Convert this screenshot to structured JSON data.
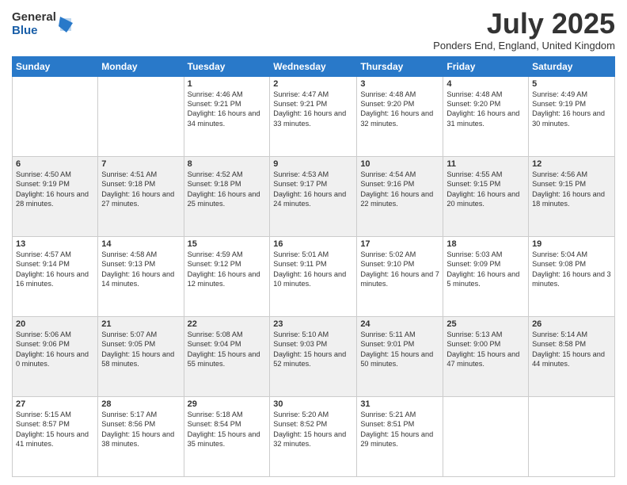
{
  "logo": {
    "general": "General",
    "blue": "Blue"
  },
  "title": "July 2025",
  "location": "Ponders End, England, United Kingdom",
  "days_header": [
    "Sunday",
    "Monday",
    "Tuesday",
    "Wednesday",
    "Thursday",
    "Friday",
    "Saturday"
  ],
  "weeks": [
    [
      {
        "day": "",
        "info": ""
      },
      {
        "day": "",
        "info": ""
      },
      {
        "day": "1",
        "info": "Sunrise: 4:46 AM\nSunset: 9:21 PM\nDaylight: 16 hours\nand 34 minutes."
      },
      {
        "day": "2",
        "info": "Sunrise: 4:47 AM\nSunset: 9:21 PM\nDaylight: 16 hours\nand 33 minutes."
      },
      {
        "day": "3",
        "info": "Sunrise: 4:48 AM\nSunset: 9:20 PM\nDaylight: 16 hours\nand 32 minutes."
      },
      {
        "day": "4",
        "info": "Sunrise: 4:48 AM\nSunset: 9:20 PM\nDaylight: 16 hours\nand 31 minutes."
      },
      {
        "day": "5",
        "info": "Sunrise: 4:49 AM\nSunset: 9:19 PM\nDaylight: 16 hours\nand 30 minutes."
      }
    ],
    [
      {
        "day": "6",
        "info": "Sunrise: 4:50 AM\nSunset: 9:19 PM\nDaylight: 16 hours\nand 28 minutes."
      },
      {
        "day": "7",
        "info": "Sunrise: 4:51 AM\nSunset: 9:18 PM\nDaylight: 16 hours\nand 27 minutes."
      },
      {
        "day": "8",
        "info": "Sunrise: 4:52 AM\nSunset: 9:18 PM\nDaylight: 16 hours\nand 25 minutes."
      },
      {
        "day": "9",
        "info": "Sunrise: 4:53 AM\nSunset: 9:17 PM\nDaylight: 16 hours\nand 24 minutes."
      },
      {
        "day": "10",
        "info": "Sunrise: 4:54 AM\nSunset: 9:16 PM\nDaylight: 16 hours\nand 22 minutes."
      },
      {
        "day": "11",
        "info": "Sunrise: 4:55 AM\nSunset: 9:15 PM\nDaylight: 16 hours\nand 20 minutes."
      },
      {
        "day": "12",
        "info": "Sunrise: 4:56 AM\nSunset: 9:15 PM\nDaylight: 16 hours\nand 18 minutes."
      }
    ],
    [
      {
        "day": "13",
        "info": "Sunrise: 4:57 AM\nSunset: 9:14 PM\nDaylight: 16 hours\nand 16 minutes."
      },
      {
        "day": "14",
        "info": "Sunrise: 4:58 AM\nSunset: 9:13 PM\nDaylight: 16 hours\nand 14 minutes."
      },
      {
        "day": "15",
        "info": "Sunrise: 4:59 AM\nSunset: 9:12 PM\nDaylight: 16 hours\nand 12 minutes."
      },
      {
        "day": "16",
        "info": "Sunrise: 5:01 AM\nSunset: 9:11 PM\nDaylight: 16 hours\nand 10 minutes."
      },
      {
        "day": "17",
        "info": "Sunrise: 5:02 AM\nSunset: 9:10 PM\nDaylight: 16 hours\nand 7 minutes."
      },
      {
        "day": "18",
        "info": "Sunrise: 5:03 AM\nSunset: 9:09 PM\nDaylight: 16 hours\nand 5 minutes."
      },
      {
        "day": "19",
        "info": "Sunrise: 5:04 AM\nSunset: 9:08 PM\nDaylight: 16 hours\nand 3 minutes."
      }
    ],
    [
      {
        "day": "20",
        "info": "Sunrise: 5:06 AM\nSunset: 9:06 PM\nDaylight: 16 hours\nand 0 minutes."
      },
      {
        "day": "21",
        "info": "Sunrise: 5:07 AM\nSunset: 9:05 PM\nDaylight: 15 hours\nand 58 minutes."
      },
      {
        "day": "22",
        "info": "Sunrise: 5:08 AM\nSunset: 9:04 PM\nDaylight: 15 hours\nand 55 minutes."
      },
      {
        "day": "23",
        "info": "Sunrise: 5:10 AM\nSunset: 9:03 PM\nDaylight: 15 hours\nand 52 minutes."
      },
      {
        "day": "24",
        "info": "Sunrise: 5:11 AM\nSunset: 9:01 PM\nDaylight: 15 hours\nand 50 minutes."
      },
      {
        "day": "25",
        "info": "Sunrise: 5:13 AM\nSunset: 9:00 PM\nDaylight: 15 hours\nand 47 minutes."
      },
      {
        "day": "26",
        "info": "Sunrise: 5:14 AM\nSunset: 8:58 PM\nDaylight: 15 hours\nand 44 minutes."
      }
    ],
    [
      {
        "day": "27",
        "info": "Sunrise: 5:15 AM\nSunset: 8:57 PM\nDaylight: 15 hours\nand 41 minutes."
      },
      {
        "day": "28",
        "info": "Sunrise: 5:17 AM\nSunset: 8:56 PM\nDaylight: 15 hours\nand 38 minutes."
      },
      {
        "day": "29",
        "info": "Sunrise: 5:18 AM\nSunset: 8:54 PM\nDaylight: 15 hours\nand 35 minutes."
      },
      {
        "day": "30",
        "info": "Sunrise: 5:20 AM\nSunset: 8:52 PM\nDaylight: 15 hours\nand 32 minutes."
      },
      {
        "day": "31",
        "info": "Sunrise: 5:21 AM\nSunset: 8:51 PM\nDaylight: 15 hours\nand 29 minutes."
      },
      {
        "day": "",
        "info": ""
      },
      {
        "day": "",
        "info": ""
      }
    ]
  ]
}
